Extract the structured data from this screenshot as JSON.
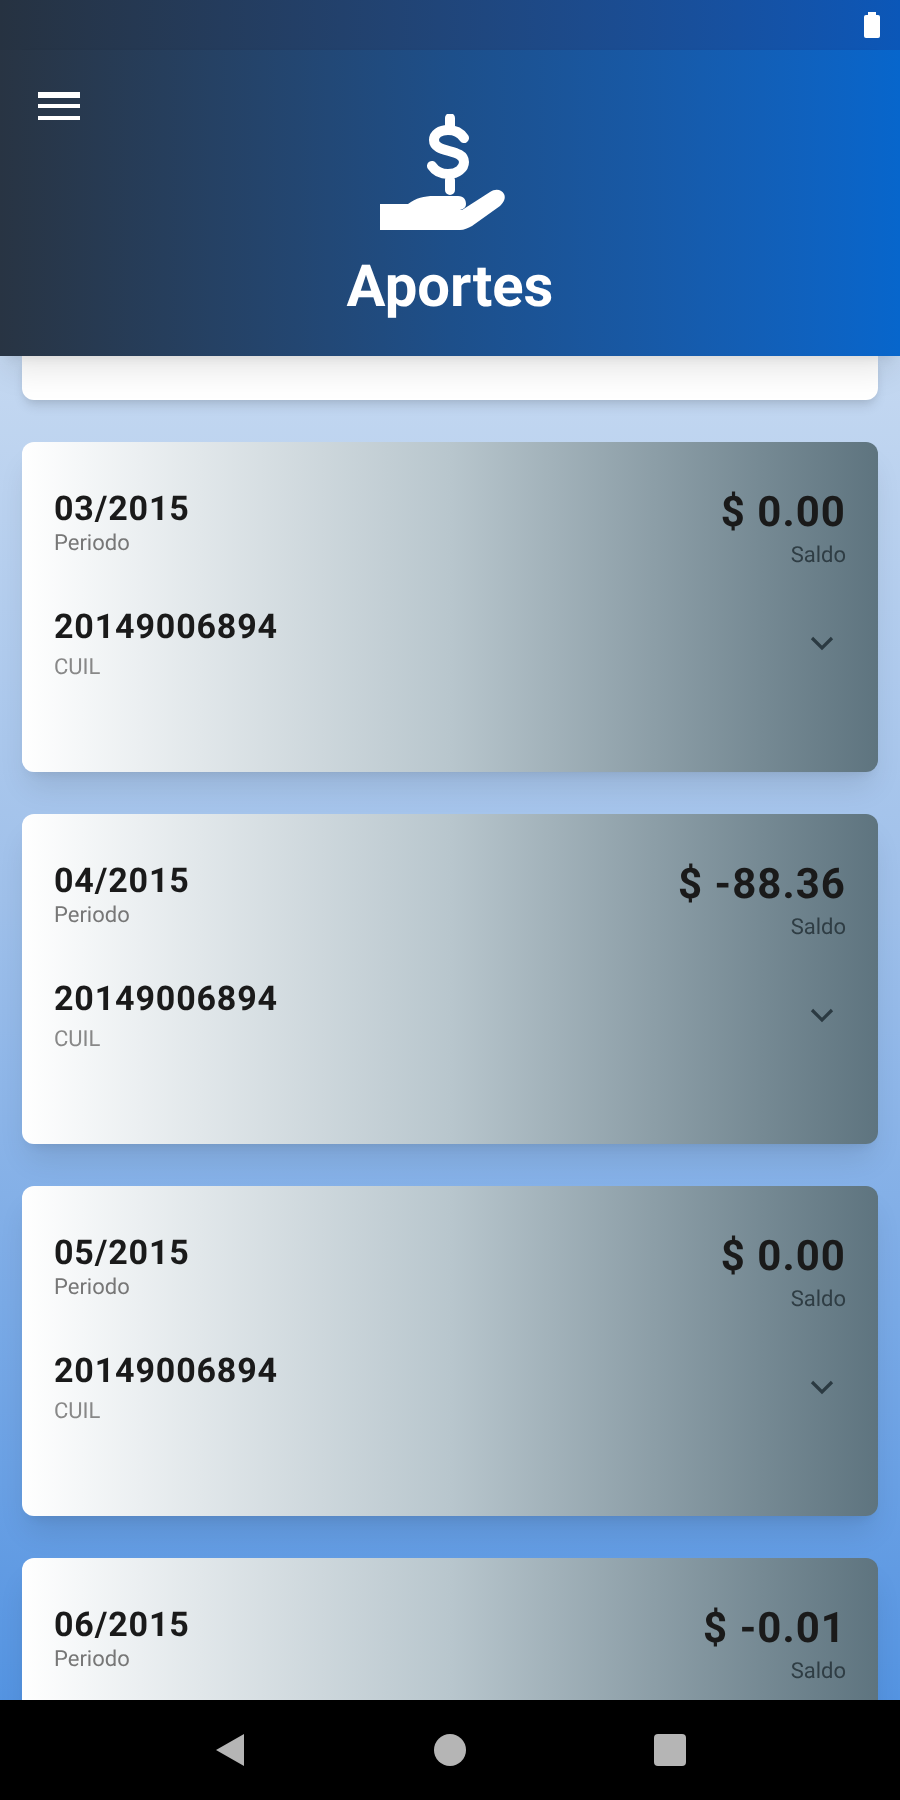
{
  "header": {
    "title": "Aportes"
  },
  "aportes": [
    {
      "period": "03/2015",
      "period_label": "Periodo",
      "saldo": "$ 0.00",
      "saldo_label": "Saldo",
      "cuil": "20149006894",
      "cuil_label": "CUIL"
    },
    {
      "period": "04/2015",
      "period_label": "Periodo",
      "saldo": "$ -88.36",
      "saldo_label": "Saldo",
      "cuil": "20149006894",
      "cuil_label": "CUIL"
    },
    {
      "period": "05/2015",
      "period_label": "Periodo",
      "saldo": "$ 0.00",
      "saldo_label": "Saldo",
      "cuil": "20149006894",
      "cuil_label": "CUIL"
    },
    {
      "period": "06/2015",
      "period_label": "Periodo",
      "saldo": "$ -0.01",
      "saldo_label": "Saldo"
    }
  ]
}
